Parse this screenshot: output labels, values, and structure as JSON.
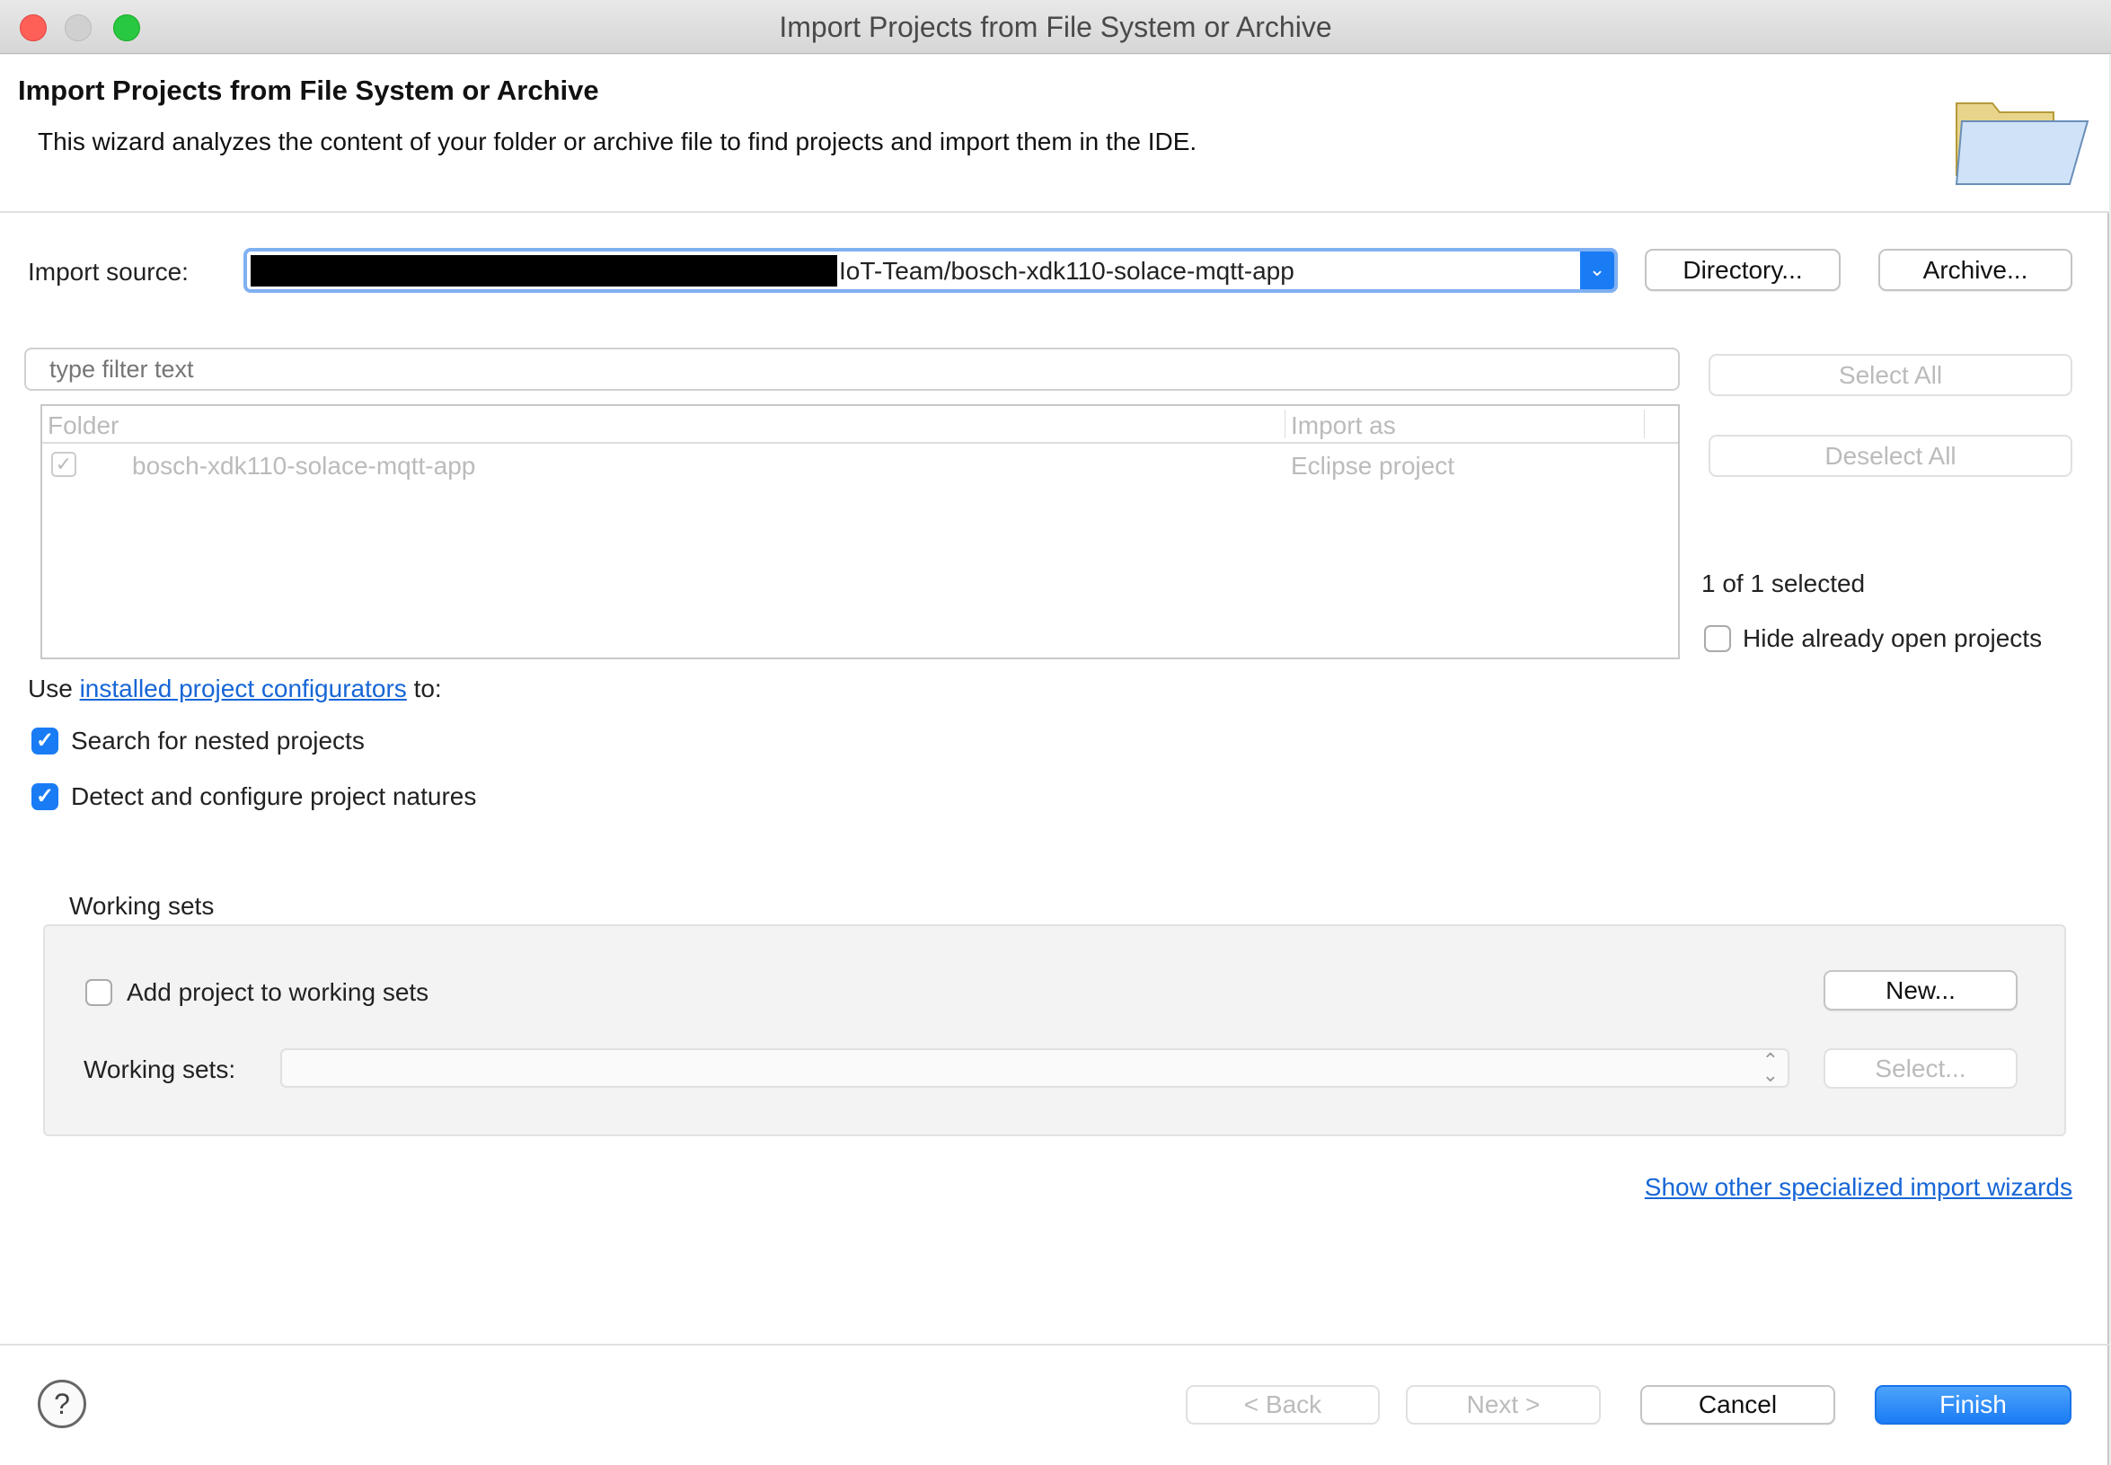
{
  "window": {
    "title": "Import Projects from File System or Archive"
  },
  "header": {
    "title": "Import Projects from File System or Archive",
    "description": "This wizard analyzes the content of your folder or archive file to find projects and import them in the IDE.",
    "icon": "folder-icon"
  },
  "source": {
    "label": "Import source:",
    "value_visible": "IoT-Team/bosch-xdk110-solace-mqtt-app",
    "directory_label": "Directory...",
    "archive_label": "Archive..."
  },
  "filter": {
    "placeholder": "type filter text"
  },
  "table": {
    "columns": [
      "Folder",
      "Import as"
    ],
    "rows": [
      {
        "folder": "bosch-xdk110-solace-mqtt-app",
        "import_as": "Eclipse project",
        "checked": true
      }
    ]
  },
  "side": {
    "select_all": "Select All",
    "deselect_all": "Deselect All",
    "selected_count": "1 of 1 selected",
    "hide_open": "Hide already open projects"
  },
  "configurators": {
    "prefix": "Use",
    "link": "installed project configurators",
    "suffix": "to:",
    "nested": "Search for nested projects",
    "natures": "Detect and configure project natures"
  },
  "working_sets": {
    "group_label": "Working sets",
    "add_label": "Add project to working sets",
    "new_label": "New...",
    "sets_label": "Working sets:",
    "select_label": "Select..."
  },
  "other_wizards_link": "Show other specialized import wizards",
  "footer": {
    "back": "< Back",
    "next": "Next >",
    "cancel": "Cancel",
    "finish": "Finish",
    "help_icon": "?"
  },
  "colors": {
    "accent": "#1a7cf5",
    "link": "#1766d6",
    "close": "#fe5f57",
    "minimize": "#d0d0d0",
    "zoom": "#28c840"
  }
}
